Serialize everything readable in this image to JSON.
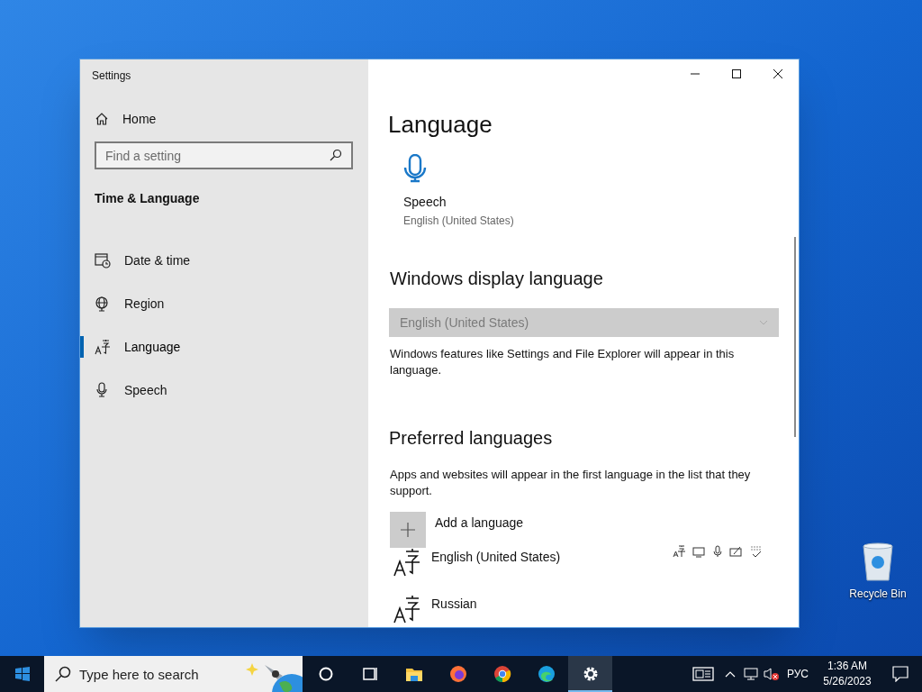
{
  "window": {
    "title": "Settings"
  },
  "sidebar": {
    "home": "Home",
    "search": {
      "placeholder": "Find a setting"
    },
    "section": "Time & Language",
    "items": [
      {
        "label": "Date & time",
        "kind": "calendar",
        "selected": false
      },
      {
        "label": "Region",
        "kind": "globe",
        "selected": false
      },
      {
        "label": "Language",
        "kind": "language",
        "selected": true
      },
      {
        "label": "Speech",
        "kind": "mic",
        "selected": false
      }
    ]
  },
  "main": {
    "title": "Language",
    "speech_tile": {
      "title": "Speech",
      "subtitle": "English (United States)"
    },
    "display_language": {
      "heading": "Windows display language",
      "value": "English (United States)",
      "disabled": true,
      "description": "Windows features like Settings and File Explorer will appear in this language."
    },
    "preferred": {
      "heading": "Preferred languages",
      "description": "Apps and websites will appear in the first language in the list that they support.",
      "add_label": "Add a language",
      "languages": [
        {
          "name": "English (United States)"
        },
        {
          "name": "Russian"
        }
      ]
    }
  },
  "desktop_icons": [
    {
      "label": "Recycle Bin"
    }
  ],
  "taskbar": {
    "search": {
      "placeholder": "Type here to search"
    },
    "apps": [
      {
        "kind": "cortana",
        "active": false
      },
      {
        "kind": "taskview",
        "active": false
      },
      {
        "kind": "explorer",
        "active": false
      },
      {
        "kind": "firefox",
        "active": false
      },
      {
        "kind": "chrome",
        "active": false
      },
      {
        "kind": "edge",
        "active": false
      },
      {
        "kind": "settings",
        "active": true
      }
    ],
    "language": "РУС",
    "time": "1:36 AM",
    "date": "5/26/2023"
  }
}
